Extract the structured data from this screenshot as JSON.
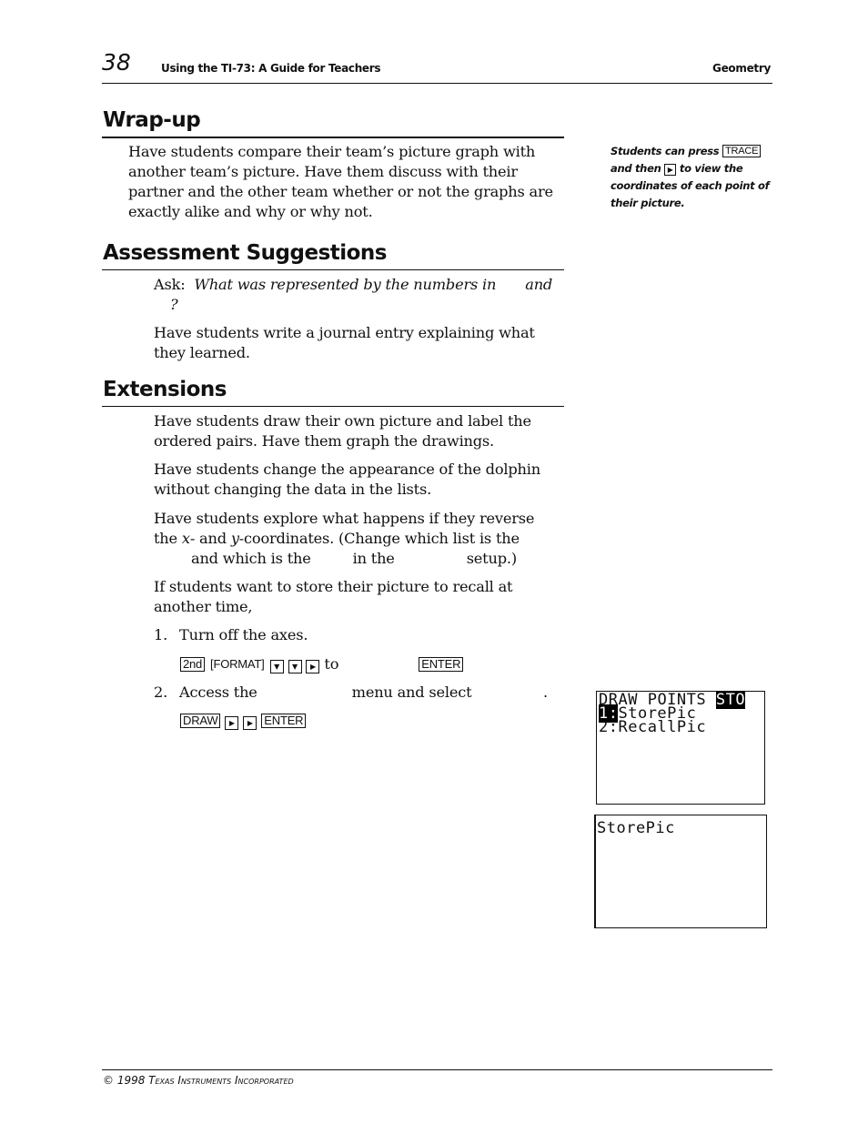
{
  "header": {
    "page_number": "38",
    "book_title": "Using the TI-73: A Guide for Teachers",
    "chapter": "Geometry"
  },
  "sections": {
    "wrapup": {
      "heading": "Wrap-up",
      "paragraph": "Have students compare their team’s picture graph with another team’s picture. Have them discuss with their partner and the other team whether or not the graphs are exactly alike and why or why not."
    },
    "assessment": {
      "heading": "Assessment Suggestions",
      "ask_label": "Ask:",
      "ask_question_part1": "What was represented by the numbers in",
      "ask_question_and": "and",
      "ask_question_end": "?",
      "paragraph2": "Have students write a journal entry explaining what they learned."
    },
    "extensions": {
      "heading": "Extensions",
      "para1": "Have students draw their own picture and label the ordered pairs. Have them graph the drawings.",
      "para2": "Have students change the appearance of the dolphin without changing the data in the lists.",
      "para3_line1": "Have students explore what happens if they reverse",
      "para3_line2_a": "the",
      "para3_line2_x": "x",
      "para3_line2_b": "- and",
      "para3_line2_y": "y",
      "para3_line2_c": "-coordinates. (Change which list is the",
      "para3_line3_a": "and which is the",
      "para3_line3_b": "in the",
      "para3_line3_c": "setup.)",
      "para4": "If students want to store their picture to recall at another time,",
      "steps": [
        {
          "number": "1.",
          "text": "Turn off the axes.",
          "keys": [
            "2nd",
            "[FORMAT]",
            "down-arrow",
            "down-arrow",
            "right-arrow"
          ],
          "keys_to": "to",
          "keys_end": "ENTER"
        },
        {
          "number": "2.",
          "text_a": "Access the",
          "text_b": "menu and select",
          "text_end": ".",
          "keys": [
            "DRAW",
            "right-arrow",
            "right-arrow",
            "ENTER"
          ]
        }
      ]
    }
  },
  "side_note": {
    "part1": "Students can press",
    "key1": "TRACE",
    "part2": "and then",
    "part3": "to view the coordinates of each point of their picture."
  },
  "screens": {
    "menu_screen": {
      "tabs": [
        "DRAW",
        "POINTS",
        "STO"
      ],
      "selected_tab": "STO",
      "items": [
        {
          "num": "1:",
          "label": "StorePic",
          "selected": true
        },
        {
          "num": "2:",
          "label": "RecallPic",
          "selected": false
        }
      ]
    },
    "home_screen": {
      "line1": "StorePic"
    }
  },
  "footer": {
    "copyright": "© 1998 Texas Instruments Incorporated"
  }
}
